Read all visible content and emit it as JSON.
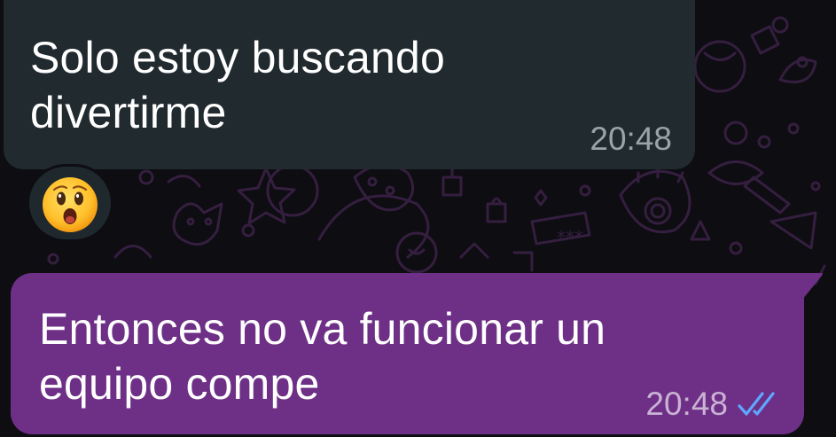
{
  "messages": [
    {
      "direction": "incoming",
      "text": "Solo estoy buscando divertirme",
      "time": "20:48",
      "reaction": "😮"
    },
    {
      "direction": "outgoing",
      "text": "Entonces no va funcionar un equipo compe",
      "time": "20:48",
      "status": "read"
    }
  ],
  "colors": {
    "background": "#0d0d12",
    "incoming_bubble": "#212a2e",
    "outgoing_bubble": "#6e2f86",
    "read_ticks": "#5da8ff",
    "wallpaper_doodle": "#3a2044"
  },
  "icons": {
    "read_status": "double-check-icon",
    "reaction": "astonished-face-emoji"
  }
}
